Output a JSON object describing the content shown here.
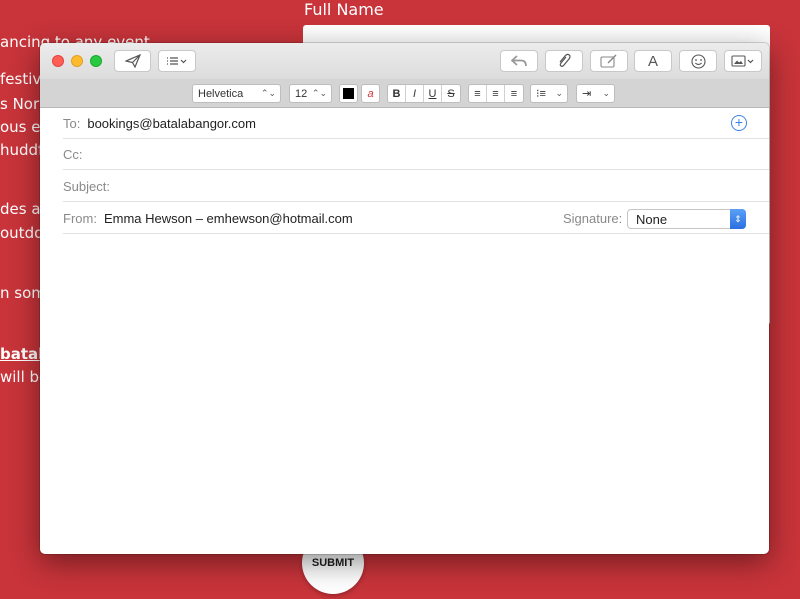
{
  "background_page": {
    "full_name_label": "Full Name",
    "snippets": [
      "ancing to any event",
      "festiv",
      "s Nor",
      "ous ev",
      "huddf",
      "des at",
      "outdo",
      "n som",
      "batala",
      "will be"
    ],
    "submit_label": "SUBMIT"
  },
  "window": {
    "toolbar": {
      "send_icon": "paper-plane-icon",
      "header_fields_icon": "list-icon",
      "reply_icon": "reply-arrow-icon",
      "attach_icon": "paperclip-icon",
      "markup_icon": "markup-icon",
      "fonts_label": "A",
      "emoji_icon": "smiley-icon",
      "photo_icon": "photo-browser-icon"
    },
    "format_bar": {
      "font_family": "Helvetica",
      "font_size": "12",
      "bold": "B",
      "italic": "I",
      "underline": "U",
      "strikethrough": "S"
    },
    "fields": {
      "to_label": "To:",
      "to_value": "bookings@batalabangor.com",
      "cc_label": "Cc:",
      "cc_value": "",
      "subject_label": "Subject:",
      "subject_value": "",
      "from_label": "From:",
      "from_value": "Emma Hewson – emhewson@hotmail.com",
      "signature_label": "Signature:",
      "signature_value": "None"
    },
    "colors": {
      "close": "#fd5f57",
      "minimize": "#fdbc2e",
      "maximize": "#28c840",
      "accent": "#3b82e6",
      "page_background": "#c8343a"
    }
  }
}
